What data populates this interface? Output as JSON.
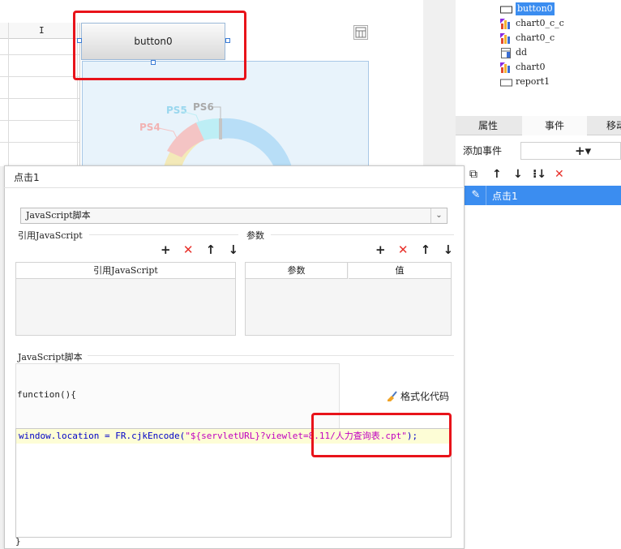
{
  "canvas": {
    "column_label": "I",
    "button_label": "button0",
    "chart_labels": [
      "PS5",
      "PS6",
      "PS4"
    ],
    "colors": {
      "ps5": "#9ad7ee",
      "ps6": "#b0b0b0",
      "ps4": "#f2b3b3"
    }
  },
  "tree": {
    "items": [
      {
        "label": "button0",
        "icon": "button-icon",
        "selected": true
      },
      {
        "label": "chart0_c_c",
        "icon": "chart-icon",
        "selected": false
      },
      {
        "label": "chart0_c",
        "icon": "chart-icon",
        "selected": false
      },
      {
        "label": "dd",
        "icon": "dropdown-icon",
        "selected": false
      },
      {
        "label": "chart0",
        "icon": "chart-icon",
        "selected": false
      },
      {
        "label": "report1",
        "icon": "report-icon",
        "selected": false
      }
    ]
  },
  "tabs": {
    "properties": "属性",
    "events": "事件",
    "move": "移动"
  },
  "events": {
    "add_label": "添加事件",
    "add_icon": "+▾",
    "rows": [
      {
        "label": "点击1"
      }
    ]
  },
  "dialog": {
    "title": "点击1",
    "type_value": "JavaScript脚本",
    "ref_js_section": "引用JavaScript",
    "ref_js_column": "引用JavaScript",
    "params_section": "参数",
    "params_columns": [
      "参数",
      "值"
    ],
    "script_section": "JavaScript脚本",
    "code_open": "function(){",
    "code_line_prefix": "window.location = FR.cjkEncode(",
    "code_line_string": "\"${servletURL}?viewlet=8.11/人力查询表.cpt\"",
    "code_line_suffix": ");",
    "code_close": "}",
    "format_button": "格式化代码"
  },
  "accent": "#3b8df0",
  "highlight_color": "#e8131a"
}
